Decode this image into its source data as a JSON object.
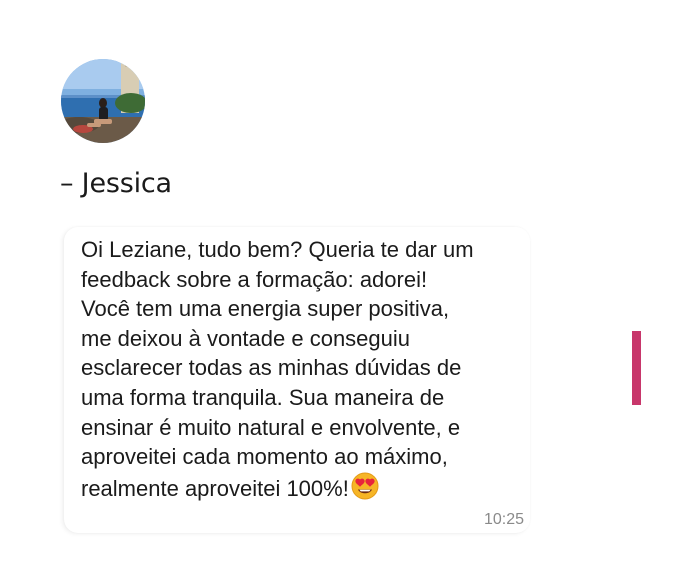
{
  "testimonial": {
    "author": "– Jessica",
    "message": "Oi Leziane, tudo bem? Queria te dar um\nfeedback sobre a formação: adorei!\nVocê tem uma energia super positiva,\nme deixou à vontade e conseguiu\nesclarecer todas as minhas dúvidas de\numa forma tranquila. Sua maneira de\nensinar é muito natural e envolvente, e\naproveitei cada momento ao máximo,\nrealmente aproveitei 100%!",
    "emoji": "heart-eyes-emoji",
    "time": "10:25"
  },
  "colors": {
    "accent": "#c8366b",
    "text": "#1b1b1b",
    "timestamp": "#8a8a8a"
  }
}
